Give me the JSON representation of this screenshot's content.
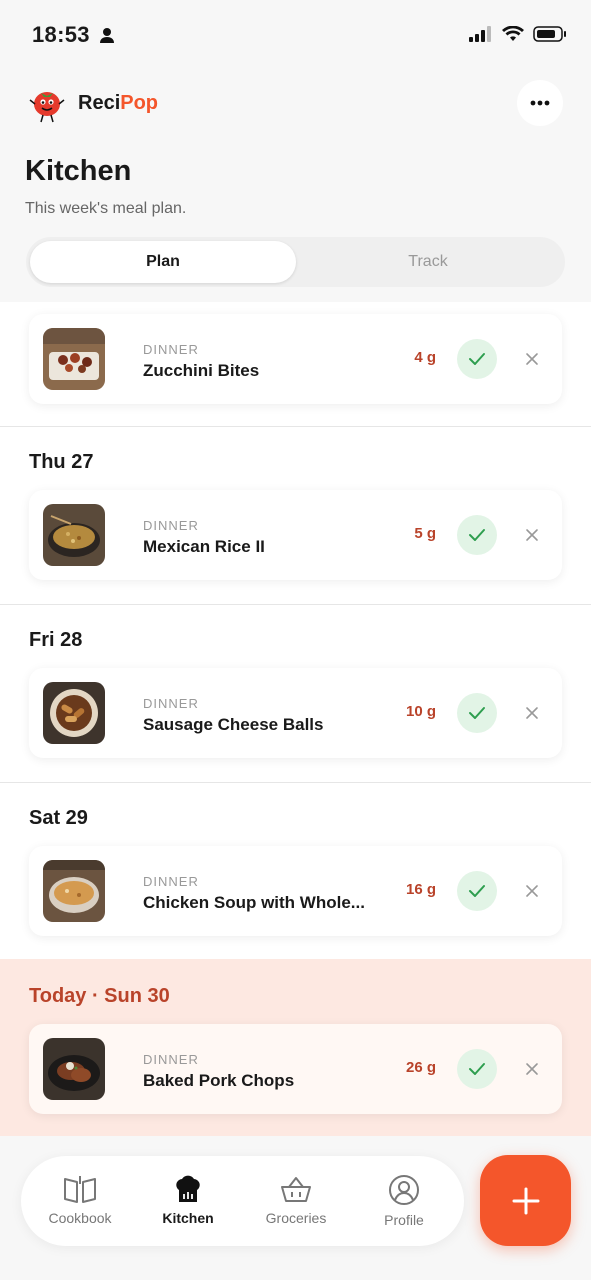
{
  "status_bar": {
    "time": "18:53"
  },
  "header": {
    "brand_prefix": "Reci",
    "brand_suffix": "Pop"
  },
  "page": {
    "title": "Kitchen",
    "subtitle": "This week's meal plan."
  },
  "segments": {
    "plan": "Plan",
    "track": "Track",
    "selected": "Plan"
  },
  "meals": [
    {
      "day": "",
      "type": "DINNER",
      "name": "Zucchini Bites",
      "amount": "4 g"
    },
    {
      "day": "Thu 27",
      "type": "DINNER",
      "name": "Mexican Rice II",
      "amount": "5 g"
    },
    {
      "day": "Fri 28",
      "type": "DINNER",
      "name": "Sausage Cheese Balls",
      "amount": "10 g"
    },
    {
      "day": "Sat 29",
      "type": "DINNER",
      "name": "Chicken Soup with Whole...",
      "amount": "16 g"
    },
    {
      "day": "Today · Sun 30",
      "type": "DINNER",
      "name": "Baked Pork Chops",
      "amount": "26 g"
    }
  ],
  "tabs": {
    "cookbook": "Cookbook",
    "kitchen": "Kitchen",
    "groceries": "Groceries",
    "profile": "Profile",
    "active": "Kitchen"
  },
  "colors": {
    "accent": "#f4562b",
    "amount_text": "#b9432a",
    "check_bg": "#e2f4e6",
    "check_icon": "#2e9e4f",
    "today_bg": "#fde8e1"
  }
}
